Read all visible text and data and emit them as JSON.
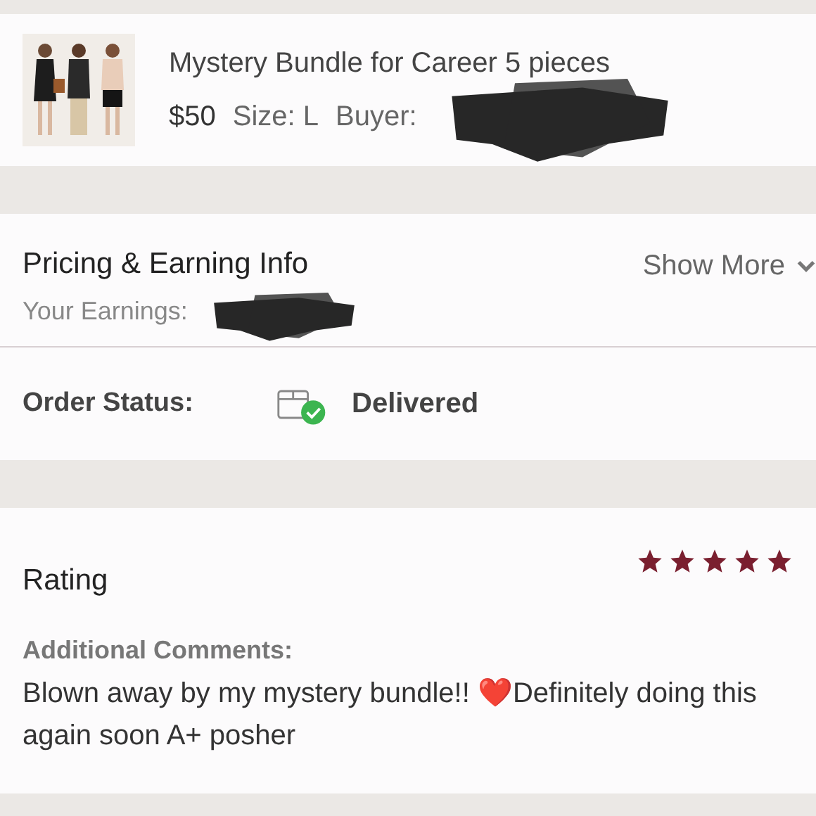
{
  "item": {
    "kind": "picture",
    "title": "Mystery Bundle for Career 5 pieces",
    "price": "$50",
    "size": "Size: L",
    "buyer_label": "Buyer:"
  },
  "pricing": {
    "title": "Pricing & Earning Info",
    "earnings_label": "Your Earnings:",
    "toggle": "Show More"
  },
  "order_status": {
    "label": "Order Status:",
    "status": "Delivered",
    "delivered": true
  },
  "rating": {
    "title": "Rating",
    "stars": 5,
    "comments_label": "Additional Comments:",
    "comment": "Blown away by my mystery bundle!! ❤️Definitely doing this again soon A+ posher"
  }
}
